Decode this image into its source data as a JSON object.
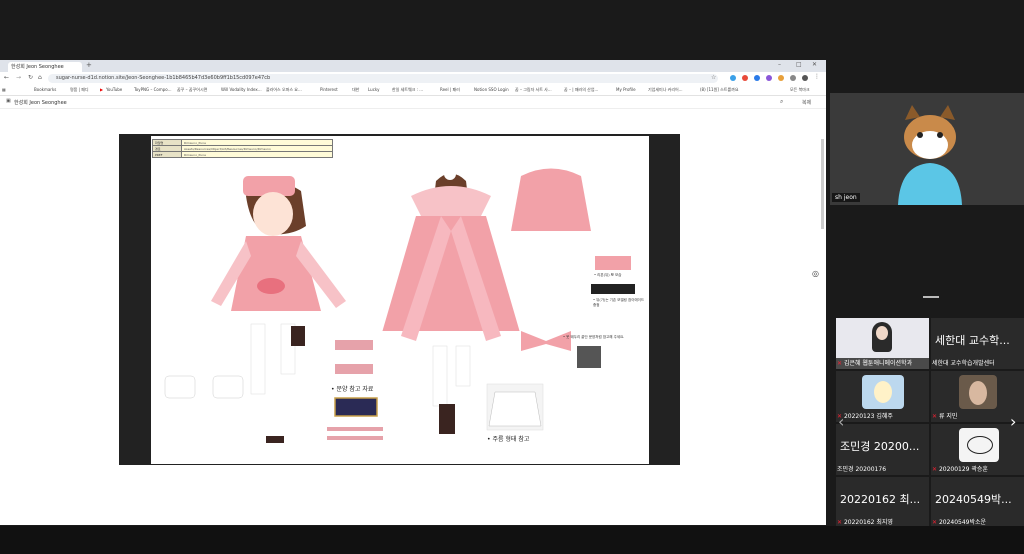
{
  "browser": {
    "tab_title": "한성희 Jeon Seonghee",
    "url": "sugar-nurse-d1d.notion.site/Jeon-Seonghee-1b1b8465b47d3e60b9ff1b15cd097e47cb",
    "bookmarks": [
      "Bookmarks",
      "명품 | 패디",
      "YouTube",
      "ToyPNG – Compo...",
      "꿈꾸 – 꿈꾸어시면",
      "Will Vodality Index...",
      "플라어스 오퍼스 요...",
      "Pinterest",
      "대한",
      "Lucky",
      "한일 세트웨크 : ...",
      "Reel | 패러",
      "Notion SSO Login",
      "꿈 – 그림자 서트 사...",
      "꿈 – | 패러의 산업...",
      "My Profile",
      "기업세미나 커리어...",
      "(8) [11원] 스트를까요",
      "모든 북마크"
    ],
    "page_title": "한성희 Jeon Seonghee",
    "page_action": "복제"
  },
  "sheet": {
    "info_rows": [
      {
        "key": "파일명",
        "value": "Rimsuno_Pune"
      },
      {
        "key": "경로",
        "value": "Assets/Resources/Object/Art/Resources/Rimsuno/Rimsuno"
      },
      {
        "key": "PREF",
        "value": "Rimsuno_Pune"
      }
    ],
    "note_pattern": "• 문양 참고 자료",
    "note_pleat": "• 주름 형태 참고",
    "note_right1": "• 리본(뒤) 뽀 모습",
    "note_right2": "• 뒤(가)는 기존 모델링 참이에이드 중점",
    "note_right3": "• 옷 돼두리 끝단 문양처럼 참고해 주세요."
  },
  "meeting": {
    "self_name": "sh jeon",
    "participants": [
      {
        "display": "",
        "name": "김은혜 웹툰애니메이션학과",
        "type": "video"
      },
      {
        "display": "세한대 교수학...",
        "name": "세한대 교수학습개발센터",
        "type": "text"
      },
      {
        "display": "",
        "name": "20220123 김혜주",
        "type": "avatar"
      },
      {
        "display": "",
        "name": "류 지민",
        "type": "photo"
      },
      {
        "display": "조민경 20200...",
        "name": "조민경 20200176",
        "type": "text"
      },
      {
        "display": "",
        "name": "20200129 곽승훈",
        "type": "avatar2"
      },
      {
        "display": "20220162 최...",
        "name": "20220162 최지영",
        "type": "text"
      },
      {
        "display": "20240549박...",
        "name": "20240549박소운",
        "type": "text"
      }
    ]
  },
  "colors": {
    "pink": "#f2a1a8",
    "pink_dark": "#d9727d",
    "hair": "#6b3f2a",
    "chrome": "#dfe3ea"
  }
}
